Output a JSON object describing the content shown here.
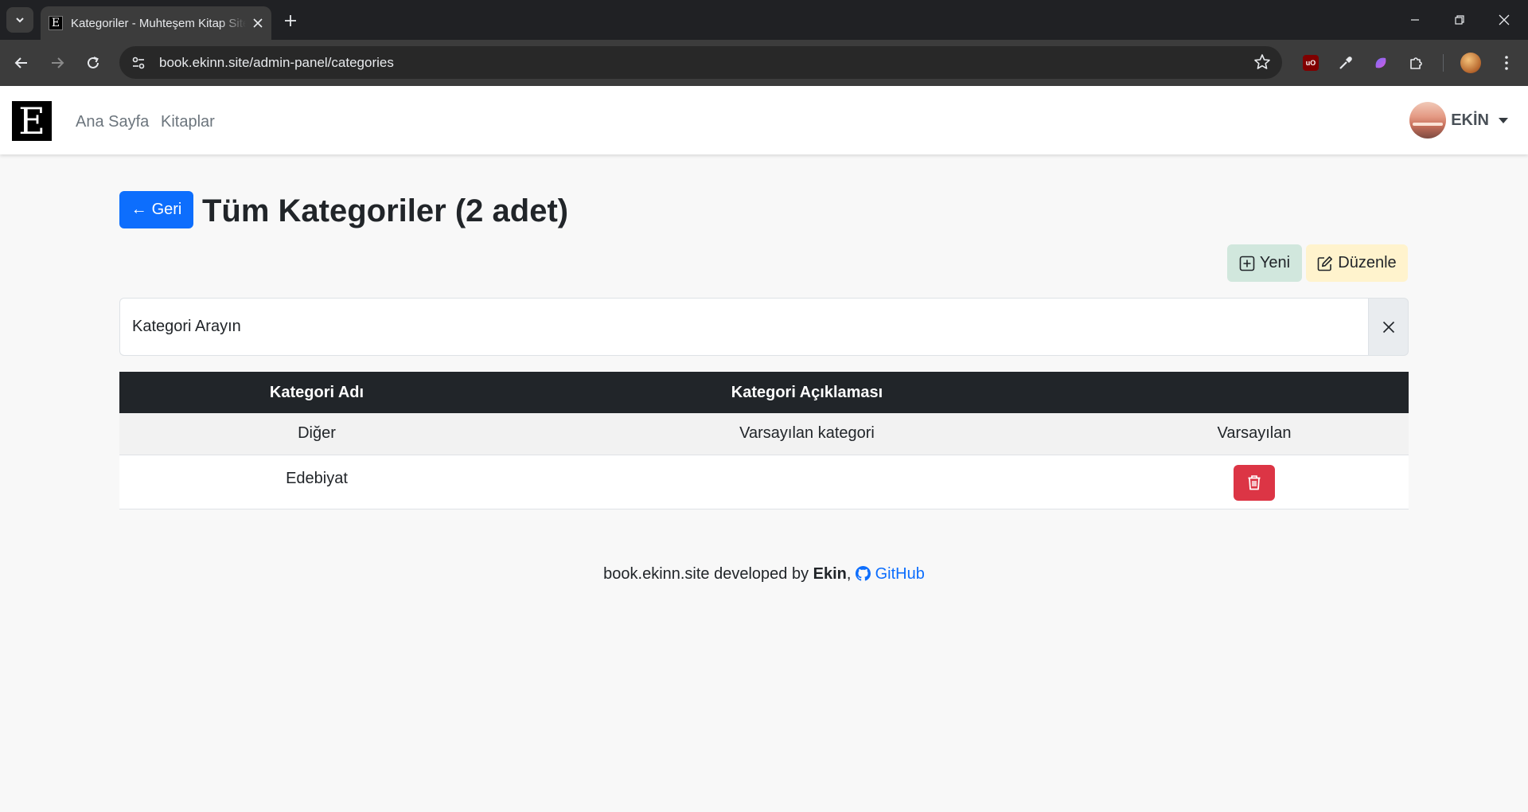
{
  "browser": {
    "tab_title": "Kategoriler - Muhteşem Kitap Sitesi",
    "tab_favicon": "E",
    "url": "book.ekinn.site/admin-panel/categories",
    "extensions": [
      "ublock-origin-icon",
      "eyedropper-icon",
      "ai-assistant-icon",
      "puzzle-icon"
    ],
    "ublock_label": "uO"
  },
  "navbar": {
    "brand_letter": "E",
    "links": [
      "Ana Sayfa",
      "Kitaplar"
    ],
    "user_name": "EKİN"
  },
  "page": {
    "back_label": "Geri",
    "back_arrow": "←",
    "title": "Tüm Kategoriler (2 adet)",
    "new_label": "Yeni",
    "edit_label": "Düzenle",
    "search_placeholder": "Kategori Arayın"
  },
  "table": {
    "headers": [
      "Kategori Adı",
      "Kategori Açıklaması",
      ""
    ],
    "rows": [
      {
        "name": "Diğer",
        "description": "Varsayılan kategori",
        "action_text": "Varsayılan"
      },
      {
        "name": "Edebiyat",
        "description": "",
        "action": "delete-button"
      }
    ]
  },
  "footer": {
    "prefix": "book.ekinn.site developed by ",
    "author": "Ekin",
    "comma": ",",
    "github_label": "GitHub"
  },
  "colors": {
    "primary": "#0d6efd",
    "danger": "#dc3545",
    "success_subtle": "#d1e7dd",
    "warning_subtle": "#fff3cd",
    "table_header": "#212529"
  }
}
